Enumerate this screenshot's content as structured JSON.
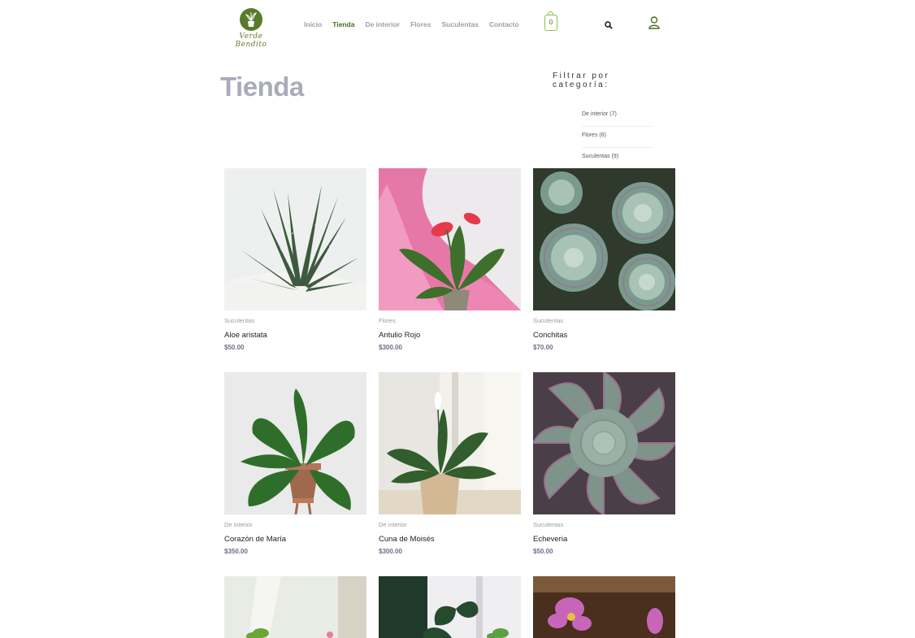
{
  "brand": {
    "name": "Verde Bendito",
    "accent": "#4d6b1e",
    "logo_bg": "#5a7a2a"
  },
  "nav": {
    "items": [
      "Inicio",
      "Tienda",
      "De interior",
      "Flores",
      "Suculentas",
      "Contacto"
    ],
    "active": "Tienda"
  },
  "cart": {
    "count": "0"
  },
  "page": {
    "title": "Tienda"
  },
  "filter": {
    "title": "Filtrar por categoría:",
    "categories": [
      "De interior (7)",
      "Flores (6)",
      "Suculentas (9)"
    ]
  },
  "products": [
    {
      "category": "Suculentas",
      "name": "Aloe aristata",
      "price": "$50.00"
    },
    {
      "category": "Flores",
      "name": "Antulio Rojo",
      "price": "$300.00"
    },
    {
      "category": "Suculentas",
      "name": "Conchitas",
      "price": "$70.00"
    },
    {
      "category": "De interior",
      "name": "Corazón de María",
      "price": "$350.00"
    },
    {
      "category": "De interior",
      "name": "Cuna de Moisés",
      "price": "$300.00"
    },
    {
      "category": "Suculentas",
      "name": "Echeveria",
      "price": "$50.00"
    }
  ],
  "icons": {
    "search": "search-icon",
    "user": "user-icon",
    "cart": "shopping-bag-icon"
  }
}
